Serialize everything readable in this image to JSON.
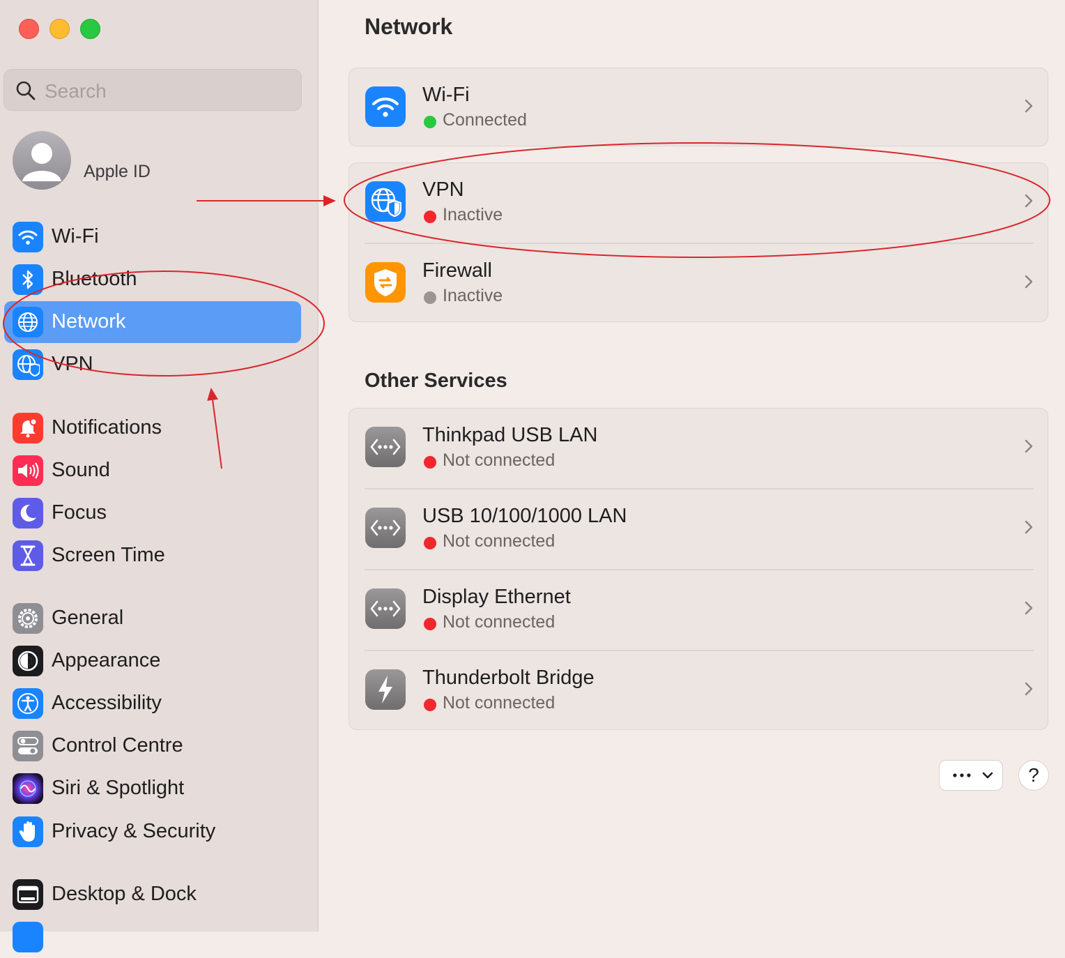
{
  "window": {
    "title": "Network"
  },
  "search": {
    "placeholder": "Search"
  },
  "apple_id": {
    "label": "Apple ID"
  },
  "sidebar": {
    "items": [
      {
        "label": "Wi-Fi",
        "icon": "wifi-icon",
        "color": "#1a84ff"
      },
      {
        "label": "Bluetooth",
        "icon": "bluetooth-icon",
        "color": "#1a84ff"
      },
      {
        "label": "Network",
        "icon": "globe-icon",
        "color": "#1a84ff",
        "selected": true
      },
      {
        "label": "VPN",
        "icon": "vpn-globe-shield-icon",
        "color": "#1a84ff"
      },
      {
        "label": "Notifications",
        "icon": "bell-icon",
        "color": "#ff3b30"
      },
      {
        "label": "Sound",
        "icon": "speaker-icon",
        "color": "#ff2d55"
      },
      {
        "label": "Focus",
        "icon": "moon-icon",
        "color": "#5e5ce6"
      },
      {
        "label": "Screen Time",
        "icon": "hourglass-icon",
        "color": "#5e5ce6"
      },
      {
        "label": "General",
        "icon": "gear-icon",
        "color": "#8e8e93"
      },
      {
        "label": "Appearance",
        "icon": "appearance-icon",
        "color": "#1c1c1e"
      },
      {
        "label": "Accessibility",
        "icon": "accessibility-icon",
        "color": "#1a84ff"
      },
      {
        "label": "Control Centre",
        "icon": "toggles-icon",
        "color": "#8e8e93"
      },
      {
        "label": "Siri & Spotlight",
        "icon": "siri-icon",
        "color": "#2b1b4a"
      },
      {
        "label": "Privacy & Security",
        "icon": "hand-icon",
        "color": "#1a84ff"
      },
      {
        "label": "Desktop & Dock",
        "icon": "dock-icon",
        "color": "#1c1c1e"
      }
    ]
  },
  "main": {
    "title": "Network",
    "primary_services": [
      {
        "title": "Wi-Fi",
        "status": "Connected",
        "status_color": "#28c840",
        "icon": "wifi-icon",
        "icon_color": "#1a84ff"
      },
      {
        "title": "VPN",
        "status": "Inactive",
        "status_color": "#f0282e",
        "icon": "vpn-globe-shield-icon",
        "icon_color": "#1a84ff"
      },
      {
        "title": "Firewall",
        "status": "Inactive",
        "status_color": "#9a9592",
        "icon": "firewall-shield-icon",
        "icon_color": "#ff9500"
      }
    ],
    "other_services_title": "Other Services",
    "other_services": [
      {
        "title": "Thinkpad USB LAN",
        "status": "Not connected",
        "status_color": "#f0282e",
        "icon": "ethernet-icon"
      },
      {
        "title": "USB 10/100/1000 LAN",
        "status": "Not connected",
        "status_color": "#f0282e",
        "icon": "ethernet-icon"
      },
      {
        "title": "Display Ethernet",
        "status": "Not connected",
        "status_color": "#f0282e",
        "icon": "ethernet-icon"
      },
      {
        "title": "Thunderbolt Bridge",
        "status": "Not connected",
        "status_color": "#f0282e",
        "icon": "thunderbolt-icon"
      }
    ],
    "more_button": {
      "icon": "ellipsis-chevron-icon"
    },
    "help_button": {
      "label": "?"
    }
  },
  "annotations": {
    "color": "#d9262b"
  }
}
